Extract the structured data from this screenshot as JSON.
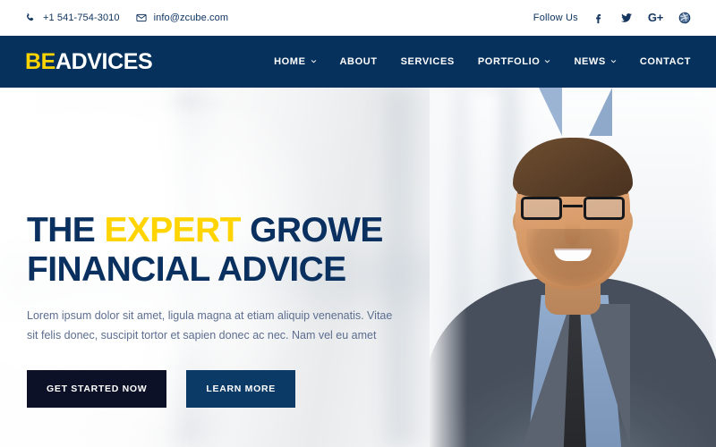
{
  "topbar": {
    "phone": {
      "icon": "phone-icon",
      "text": "+1 541-754-3010"
    },
    "email": {
      "icon": "mail-icon",
      "text": "info@zcube.com"
    },
    "follow_label": "Follow Us",
    "socials": [
      {
        "name": "facebook-icon",
        "label": "f"
      },
      {
        "name": "twitter-icon",
        "label": ""
      },
      {
        "name": "google-plus-icon",
        "label": "G+"
      },
      {
        "name": "dribbble-icon",
        "label": ""
      }
    ]
  },
  "header": {
    "logo": {
      "part1": "BE",
      "part2": "ADVICES"
    },
    "nav": [
      {
        "label": "HOME",
        "has_dropdown": true
      },
      {
        "label": "ABOUT",
        "has_dropdown": false
      },
      {
        "label": "SERVICES",
        "has_dropdown": false
      },
      {
        "label": "PORTFOLIO",
        "has_dropdown": true
      },
      {
        "label": "NEWS",
        "has_dropdown": true
      },
      {
        "label": "CONTACT",
        "has_dropdown": false
      }
    ]
  },
  "hero": {
    "headline_line1_a": "THE ",
    "headline_line1_b": "EXPERT",
    "headline_line1_c": " GROWE",
    "headline_line2": "FINANCIAL ADVICE",
    "subtext": "Lorem ipsum dolor sit amet, ligula magna at etiam aliquip venenatis. Vitae sit felis donec, suscipit tortor et sapien donec ac nec. Nam vel eu amet",
    "primary_button": "GET STARTED NOW",
    "secondary_button": "LEARN MORE",
    "image_alt": "smiling-businessman-in-grey-suit-with-glasses"
  },
  "colors": {
    "brand_navy": "#06315c",
    "brand_yellow": "#ffd400",
    "headline_navy": "#0a3060",
    "subtext_slate": "#5d6e90",
    "btn_primary_bg": "#0d1128",
    "btn_secondary_bg": "#0c3a66",
    "topbar_text": "#0e3460"
  }
}
